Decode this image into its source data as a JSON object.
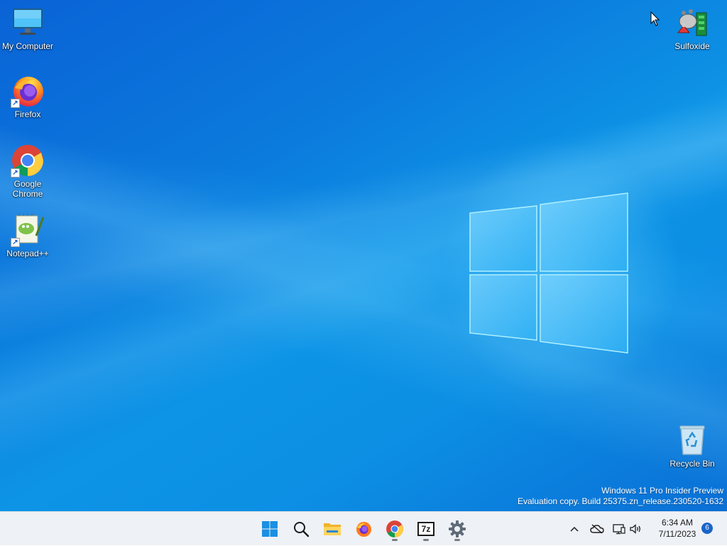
{
  "desktop": {
    "icons": [
      {
        "label": "My Computer",
        "icon": "computer-icon"
      },
      {
        "label": "Firefox",
        "icon": "firefox-icon"
      },
      {
        "label": "Google\nChrome",
        "icon": "chrome-icon"
      },
      {
        "label": "Notepad++",
        "icon": "notepadpp-icon"
      },
      {
        "label": "Sulfoxide",
        "icon": "sulfoxide-icon"
      },
      {
        "label": "Recycle Bin",
        "icon": "recycle-bin-icon"
      }
    ],
    "watermark": {
      "line1": "Windows 11 Pro Insider Preview",
      "line2": "Evaluation copy. Build 25375.zn_release.230520-1632"
    }
  },
  "taskbar": {
    "apps": [
      {
        "name": "start",
        "icon": "windows-start-icon",
        "running": false
      },
      {
        "name": "search",
        "icon": "search-icon",
        "running": false
      },
      {
        "name": "file-explorer",
        "icon": "folder-icon",
        "running": false
      },
      {
        "name": "firefox",
        "icon": "firefox-icon",
        "running": false
      },
      {
        "name": "chrome",
        "icon": "chrome-icon",
        "running": true
      },
      {
        "name": "7zip",
        "icon": "7zip-icon",
        "label": "7z",
        "running": true
      },
      {
        "name": "settings",
        "icon": "gear-icon",
        "running": true
      }
    ],
    "tray": {
      "time": "6:34 AM",
      "date": "7/11/2023",
      "notification_count": "6"
    }
  },
  "colors": {
    "taskbar_bg": "#eef1f6",
    "accent": "#1a64c8"
  }
}
